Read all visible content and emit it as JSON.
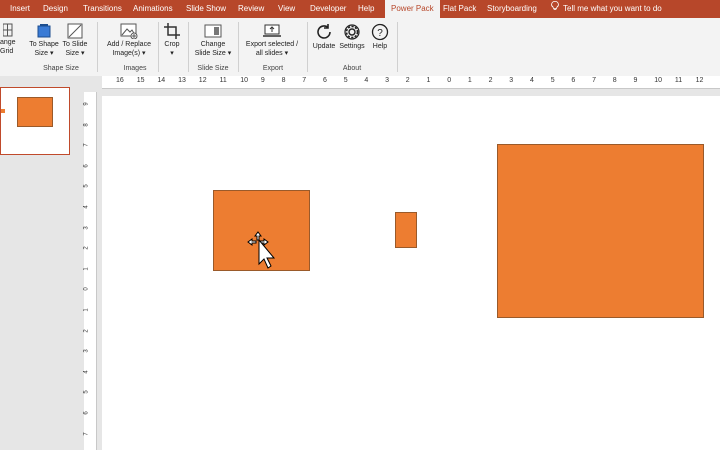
{
  "tabs": [
    "Insert",
    "Design",
    "Transitions",
    "Animations",
    "Slide Show",
    "Review",
    "View",
    "Developer",
    "Help",
    "Power Pack",
    "Flat Pack",
    "Storyboarding"
  ],
  "active_tab": "Power Pack",
  "tellme": "Tell me what you want to do",
  "ribbon": {
    "arrange_grid": "ange\nGrid",
    "to_shape_size": "To Shape\nSize",
    "to_slide_size": "To Slide\nSize",
    "add_replace": "Add / Replace\nImage(s)",
    "crop": "Crop",
    "change_slide_size": "Change\nSlide Size",
    "export_selected": "Export selected /\nall slides",
    "update": "Update",
    "settings": "Settings",
    "help": "Help",
    "groups": {
      "shape_size": "Shape Size",
      "images": "Images",
      "slide_size": "Slide Size",
      "export": "Export",
      "about": "About"
    }
  },
  "ruler_h": [
    "16",
    "15",
    "14",
    "13",
    "12",
    "11",
    "10",
    "9",
    "8",
    "7",
    "6",
    "5",
    "4",
    "3",
    "2",
    "1",
    "0",
    "1",
    "2",
    "3",
    "4",
    "5",
    "6",
    "7",
    "8",
    "9",
    "10",
    "11",
    "12"
  ],
  "ruler_v": [
    "9",
    "8",
    "7",
    "6",
    "5",
    "4",
    "3",
    "2",
    "1",
    "0",
    "1",
    "2",
    "3",
    "4",
    "5",
    "6",
    "7"
  ],
  "colors": {
    "accent": "#b7472a",
    "shape_fill": "#ed7d31"
  }
}
